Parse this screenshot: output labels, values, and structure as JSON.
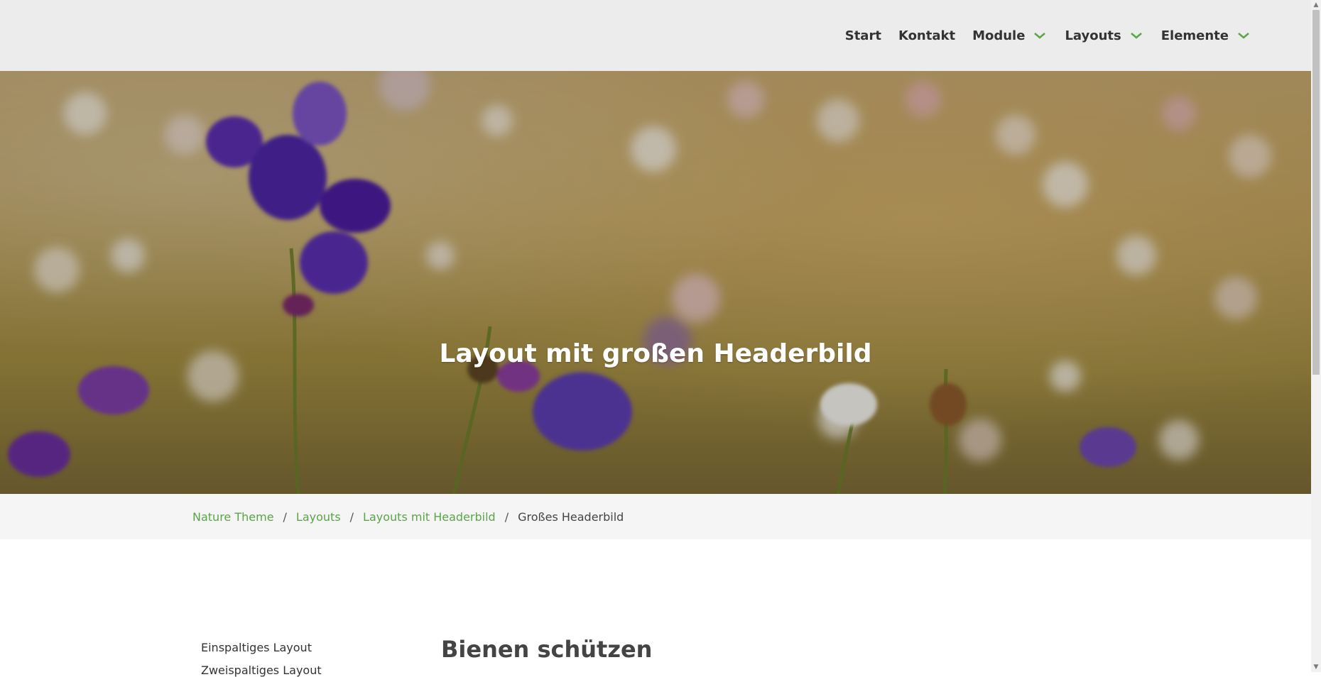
{
  "nav": {
    "items": [
      {
        "label": "Start",
        "has_dropdown": false
      },
      {
        "label": "Kontakt",
        "has_dropdown": false
      },
      {
        "label": "Module",
        "has_dropdown": true
      },
      {
        "label": "Layouts",
        "has_dropdown": true
      },
      {
        "label": "Elemente",
        "has_dropdown": true
      }
    ]
  },
  "hero": {
    "title": "Layout mit großen Headerbild"
  },
  "breadcrumb": {
    "items": [
      "Nature Theme",
      "Layouts",
      "Layouts mit Headerbild"
    ],
    "separator": "/",
    "current": "Großes Headerbild"
  },
  "sidebar": {
    "items": [
      "Einspaltiges Layout",
      "Zweispaltiges Layout"
    ]
  },
  "content": {
    "title": "Bienen schützen"
  },
  "colors": {
    "accent": "#5aa547",
    "topbar_bg": "#ececec",
    "breadcrumb_bg": "#f5f5f5",
    "text": "#333333"
  }
}
